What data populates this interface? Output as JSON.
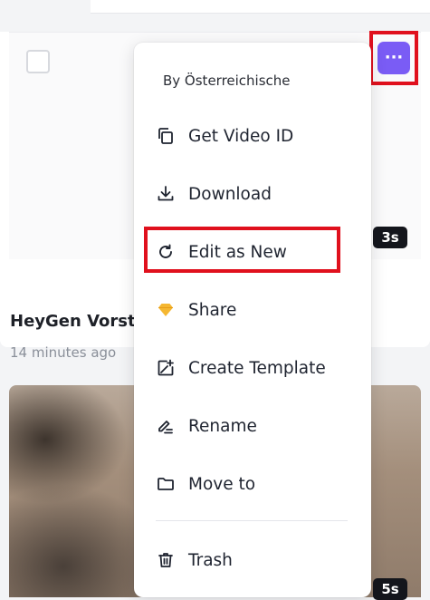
{
  "video_card_1": {
    "title": "HeyGen Vorst",
    "meta": "14 minutes ago",
    "duration": "3s",
    "more_button_label": "···"
  },
  "video_card_2": {
    "duration": "5s"
  },
  "context_menu": {
    "header": "By Österreichische",
    "items": [
      {
        "label": "Get Video ID",
        "icon": "copy-icon"
      },
      {
        "label": "Download",
        "icon": "download-icon"
      },
      {
        "label": "Edit as New",
        "icon": "refresh-icon"
      },
      {
        "label": "Share",
        "icon": "diamond-icon"
      },
      {
        "label": "Create Template",
        "icon": "template-plus-icon"
      },
      {
        "label": "Rename",
        "icon": "rename-icon"
      },
      {
        "label": "Move to",
        "icon": "folder-icon"
      },
      {
        "label": "Trash",
        "icon": "trash-icon"
      }
    ]
  },
  "colors": {
    "accent": "#7a5cf5",
    "highlight": "#e0101d",
    "share_icon": "#f5b731"
  }
}
